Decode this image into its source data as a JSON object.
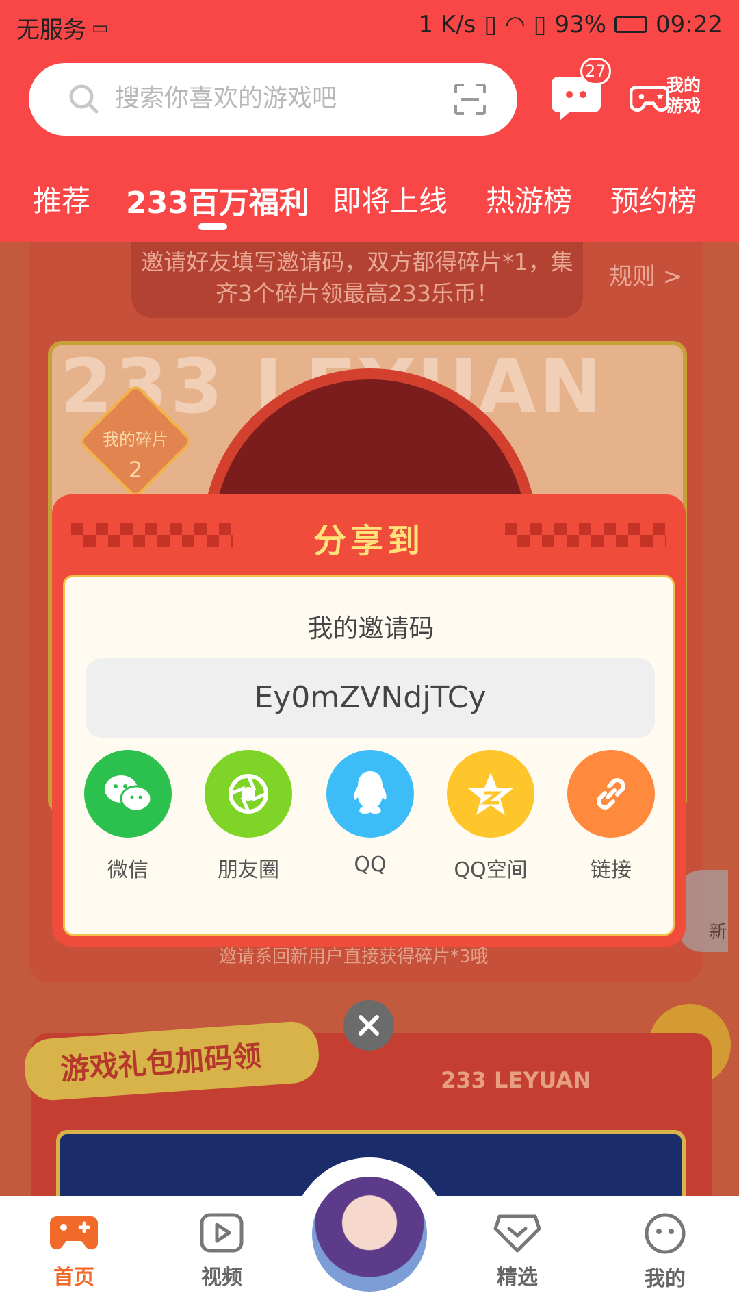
{
  "status_bar": {
    "carrier": "无服务",
    "net_speed": "1 K/s",
    "battery": "93%",
    "time": "09:22"
  },
  "search": {
    "placeholder": "搜索你喜欢的游戏吧"
  },
  "header": {
    "message_count": "27",
    "my_games_label": "我的游戏"
  },
  "tabs": [
    {
      "label": "推荐"
    },
    {
      "label": "233百万福利"
    },
    {
      "label": "即将上线"
    },
    {
      "label": "热游榜"
    },
    {
      "label": "预约榜"
    }
  ],
  "background": {
    "rule_banner": "邀请好友填写邀请码，双方都得碎片*1，集齐3个碎片领最高233乐币！",
    "rule_link": "规则 >",
    "leyuan_text": "233 LEYUAN",
    "my_fragments_label": "我的碎片",
    "my_fragments_count": "2",
    "refresh_label": "新",
    "invite_hint": "邀请系回新用户直接获得碎片*3哦",
    "gift_title": "游戏礼包加码领",
    "leyuan_tag": "233 LEYUAN"
  },
  "dialog": {
    "title": "分享到",
    "code_label": "我的邀请码",
    "invite_code": "Ey0mZVNdjTCy",
    "share_options": [
      {
        "label": "微信",
        "icon": "wechat-icon",
        "color": "#2cc14e"
      },
      {
        "label": "朋友圈",
        "icon": "moments-icon",
        "color": "#7ed427"
      },
      {
        "label": "QQ",
        "icon": "qq-icon",
        "color": "#3cbdf8"
      },
      {
        "label": "QQ空间",
        "icon": "qzone-icon",
        "color": "#ffc62b"
      },
      {
        "label": "链接",
        "icon": "link-icon",
        "color": "#ff8a3d"
      }
    ]
  },
  "bottom_nav": [
    {
      "label": "首页",
      "icon": "home-gamepad-icon",
      "active": true
    },
    {
      "label": "视频",
      "icon": "video-icon",
      "active": false
    },
    {
      "label": "精选",
      "icon": "featured-heart-icon",
      "active": false
    },
    {
      "label": "我的",
      "icon": "profile-face-icon",
      "active": false
    }
  ],
  "colors": {
    "brand_red": "#f94747",
    "active_orange": "#f26a2a"
  }
}
